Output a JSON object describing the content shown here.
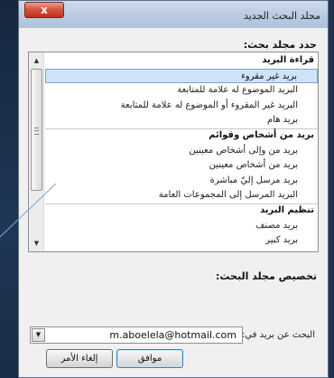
{
  "dialog": {
    "title": "مجلد البحث الجديد",
    "close_label": "x"
  },
  "select_label": "حدد مجلد بحث:",
  "list": {
    "rows": [
      {
        "kind": "header",
        "label": "قراءة البريد"
      },
      {
        "kind": "item",
        "label": "بريد غير مقروء",
        "selected": true
      },
      {
        "kind": "item",
        "label": "البريد الموضوع له علامة للمتابعة"
      },
      {
        "kind": "item",
        "label": "البريد غير المقروء أو الموضوع له علامة للمتابعة"
      },
      {
        "kind": "item",
        "label": "بريد هام"
      },
      {
        "kind": "header",
        "label": "بريد من أشخاص وقوائم"
      },
      {
        "kind": "item",
        "label": "بريد من وإلى أشخاص معينين"
      },
      {
        "kind": "item",
        "label": "بريد من أشخاص معينين"
      },
      {
        "kind": "item",
        "label": "بريد مرسل إليّ مباشرة"
      },
      {
        "kind": "item",
        "label": "البريد المرسل إلى المجموعات العامة"
      },
      {
        "kind": "header",
        "label": "تنظيم البريد"
      },
      {
        "kind": "item",
        "label": "بريد مصنف"
      },
      {
        "kind": "item",
        "label": "بريد كبير"
      }
    ]
  },
  "customize_label": "تخصيص مجلد البحث:",
  "search": {
    "label": "البحث عن بريد في:",
    "value": "m.aboelela@hotmail.com"
  },
  "buttons": {
    "ok": "موافق",
    "cancel": "إلغاء الأمر"
  },
  "colors": {
    "selection": "#cfe3f8",
    "close": "#c0301b"
  }
}
